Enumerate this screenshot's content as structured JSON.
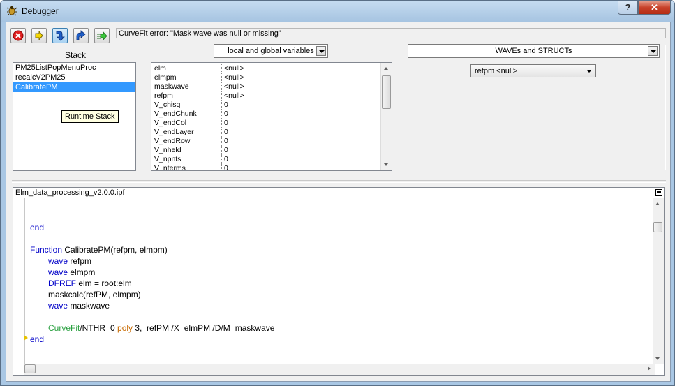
{
  "window": {
    "title": "Debugger"
  },
  "toolbar": {
    "error_message": "CurveFit error: \"Mask wave was null or missing\""
  },
  "stack": {
    "label": "Stack",
    "items": [
      "PM25ListPopMenuProc",
      "recalcV2PM25",
      "CalibratePM"
    ],
    "tooltip": "Runtime Stack"
  },
  "variables": {
    "dropdown": "local and global variables",
    "rows": [
      {
        "name": "elm",
        "value": "<null>"
      },
      {
        "name": "elmpm",
        "value": "<null>"
      },
      {
        "name": "maskwave",
        "value": "<null>"
      },
      {
        "name": "refpm",
        "value": "<null>"
      },
      {
        "name": "V_chisq",
        "value": "0"
      },
      {
        "name": "V_endChunk",
        "value": "0"
      },
      {
        "name": "V_endCol",
        "value": "0"
      },
      {
        "name": "V_endLayer",
        "value": "0"
      },
      {
        "name": "V_endRow",
        "value": "0"
      },
      {
        "name": "V_nheld",
        "value": "0"
      },
      {
        "name": "V_npnts",
        "value": "0"
      },
      {
        "name": "V_nterms",
        "value": "0"
      }
    ]
  },
  "waves": {
    "dropdown": "WAVEs and STRUCTs",
    "selector": "refpm <null>"
  },
  "editor": {
    "filename": "Elm_data_processing_v2.0.0.ipf",
    "lines": {
      "l1": "end",
      "l2_kw": "Function",
      "l2_rest": " CalibratePM(refpm, elmpm)",
      "l3_kw": "wave",
      "l3_rest": " refpm",
      "l4_kw": "wave",
      "l4_rest": " elmpm",
      "l5_kw": "DFREF",
      "l5_rest": " elm = root:elm",
      "l6": "maskcalc(refPM, elmpm)",
      "l7_kw": "wave",
      "l7_rest": " maskwave",
      "l8_op": "CurveFit",
      "l8_a": "/NTHR=0 ",
      "l8_kw": "poly",
      "l8_b": " 3,  refPM /X=elmPM /D/M=maskwave",
      "l9": "end"
    }
  },
  "colors": {
    "keyword": "#0000c8",
    "operation": "#2aa040",
    "curvefit_keyword": "#c86a00",
    "selection": "#3399ff"
  }
}
